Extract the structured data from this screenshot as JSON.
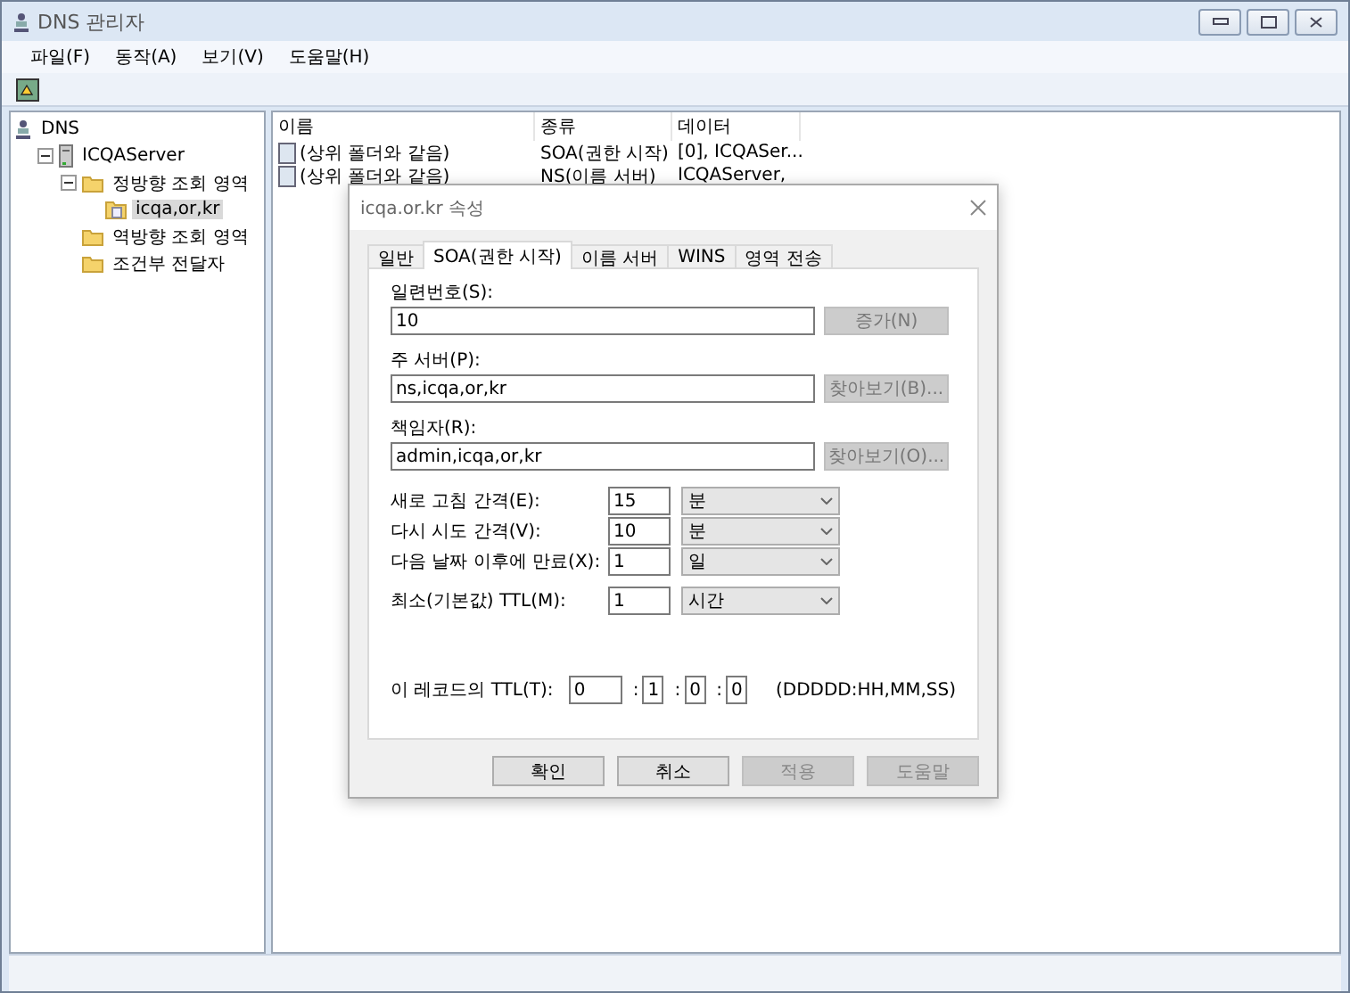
{
  "window": {
    "title": "DNS 관리자"
  },
  "menu": [
    "파일(F)",
    "동작(A)",
    "보기(V)",
    "도움말(H)"
  ],
  "tree": [
    {
      "label": "DNS",
      "kind": "root",
      "selected": false,
      "children": [
        {
          "label": "ICQAServer",
          "kind": "server",
          "expanded": true,
          "selected": false,
          "children": [
            {
              "label": "정방향 조회 영역",
              "kind": "folder",
              "expanded": true,
              "selected": false,
              "children": [
                {
                  "label": "icqa,or,kr",
                  "kind": "zone",
                  "selected": true
                }
              ]
            },
            {
              "label": "역방향 조회 영역",
              "kind": "folder",
              "selected": false
            },
            {
              "label": "조건부 전달자",
              "kind": "folder",
              "selected": false
            }
          ]
        }
      ]
    }
  ],
  "list": {
    "columns": [
      "이름",
      "종류",
      "데이터"
    ],
    "rows": [
      {
        "cells": [
          "(상위 폴더와 같음)",
          "SOA(권한 시작)",
          "[0], ICQASer..."
        ]
      },
      {
        "cells": [
          "(상위 폴더와 같음)",
          "NS(이름 서버)",
          "ICQAServer,"
        ]
      }
    ]
  },
  "dialog": {
    "title": "icqa.or.kr 속성",
    "tabs": [
      {
        "label": "일반",
        "selected": false
      },
      {
        "label": "SOA(권한 시작)",
        "selected": true
      },
      {
        "label": "이름 서버",
        "selected": false
      },
      {
        "label": "WINS",
        "selected": false
      },
      {
        "label": "영역 전송",
        "selected": false
      }
    ],
    "fields": [
      {
        "label": "일련번호(S):",
        "value": "10",
        "button": "증가(N)",
        "disabled": true
      },
      {
        "label": "주 서버(P):",
        "value": "ns,icqa,or,kr",
        "button": "찾아보기(B)...",
        "disabled": true
      },
      {
        "label": "책임자(R):",
        "value": "admin,icqa,or,kr",
        "button": "찾아보기(O)...",
        "disabled": true
      }
    ],
    "intervals": [
      {
        "label": "새로 고침 간격(E):",
        "value": "15",
        "unit": "분"
      },
      {
        "label": "다시 시도 간격(V):",
        "value": "10",
        "unit": "분"
      },
      {
        "label": "다음 날짜 이후에 만료(X):",
        "value": "1",
        "unit": "일"
      },
      {
        "label": "최소(기본값) TTL(M):",
        "value": "1",
        "unit": "시간"
      }
    ],
    "ttl": {
      "label": "이 레코드의 TTL(T):",
      "parts": [
        "0",
        "1",
        "0",
        "0"
      ],
      "separator": ":",
      "format": "(DDDDD:HH,MM,SS)"
    },
    "buttons": [
      {
        "label": "확인",
        "disabled": false
      },
      {
        "label": "취소",
        "disabled": false
      },
      {
        "label": "적용",
        "disabled": true
      },
      {
        "label": "도움말",
        "disabled": true
      }
    ]
  }
}
